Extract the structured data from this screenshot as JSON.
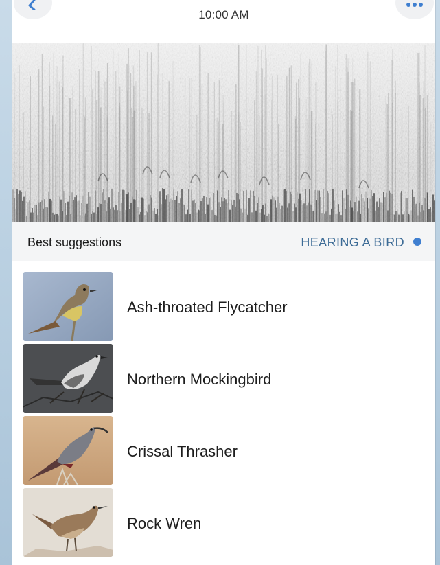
{
  "status": {
    "time": "10:00 AM"
  },
  "nav": {
    "back_icon": "chevron-left-icon",
    "more_icon": "more-dots-icon",
    "accent": "#3f7fd0"
  },
  "suggestions": {
    "title": "Best suggestions",
    "status_text": "HEARING A BIRD",
    "status_color": "#3c6b96"
  },
  "birds": [
    {
      "name": "Ash-throated Flycatcher"
    },
    {
      "name": "Northern Mockingbird"
    },
    {
      "name": "Crissal Thrasher"
    },
    {
      "name": "Rock Wren"
    }
  ]
}
